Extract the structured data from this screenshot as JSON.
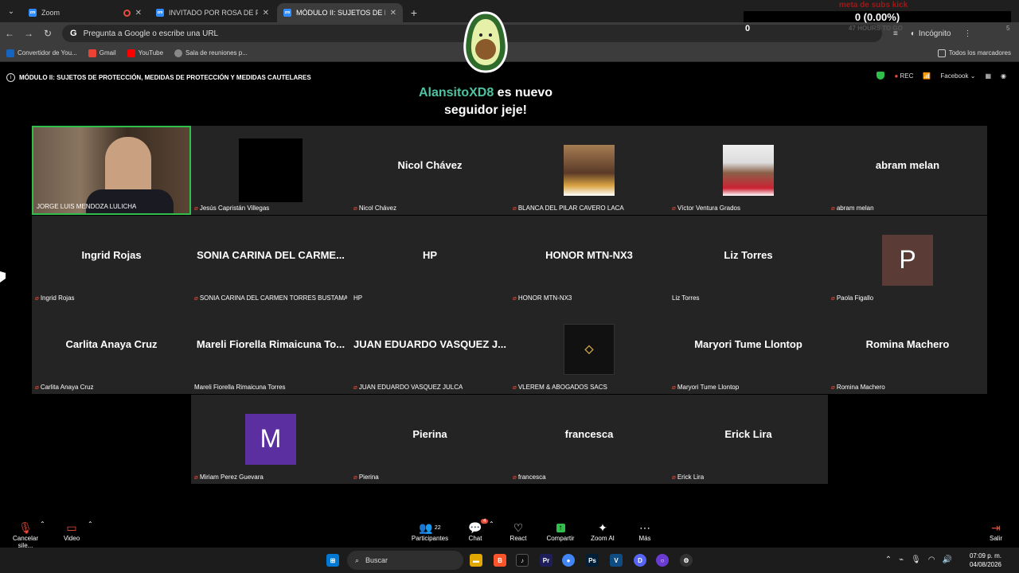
{
  "browser": {
    "tabs": [
      {
        "title": "Zoom",
        "favicon": "zoom-icon",
        "active": false
      },
      {
        "title": "INVITADO POR ROSA DE PAZ",
        "favicon": "zoom-icon",
        "active": false
      },
      {
        "title": "MÓDULO II: SUJETOS DE PF",
        "favicon": "zoom-icon",
        "active": true
      }
    ],
    "omnibox_placeholder": "Pregunta a Google o escribe una URL",
    "incognito_label": "Incógnito",
    "bookmarks": [
      "Convertidor de You...",
      "Gmail",
      "YouTube",
      "Sala de reuniones p..."
    ],
    "bookmarks_all": "Todos los marcadores"
  },
  "overlay": {
    "subs_title": "meta de subs kick",
    "subs_count": "0 (0.00%)",
    "subs_start": "0",
    "subs_hours": "47 HOURS TO GO",
    "subs_goal": "5",
    "follower_name": "AlansitoXD8",
    "follower_text_1": "es nuevo",
    "follower_text_2": "seguidor jeje!"
  },
  "meeting": {
    "title": "MÓDULO II: SUJETOS DE PROTECCIÓN, MEDIDAS DE PROTECCIÓN Y MEDIDAS CAUTELARES",
    "rec_label": "REC",
    "stream_label": "Facebook",
    "colors": {
      "green": "#2fbf4a",
      "red": "#e74c3c",
      "accent": "#4fc3a1"
    }
  },
  "participants": [
    {
      "label": "JORGE LUIS MENDOZA LULICHA",
      "display": "",
      "kind": "video",
      "muted": false,
      "speaking": true
    },
    {
      "label": "Jesús Capristán Villegas",
      "display": "",
      "kind": "black",
      "muted": true
    },
    {
      "label": "Nicol Chávez",
      "display": "Nicol Chávez",
      "kind": "name",
      "muted": true
    },
    {
      "label": "BLANCA DEL PILAR CAVERO LACA",
      "display": "",
      "kind": "photo-woman",
      "muted": true
    },
    {
      "label": "Víctor Ventura Grados",
      "display": "",
      "kind": "photo-man",
      "muted": true
    },
    {
      "label": "abram melan",
      "display": "abram melan",
      "kind": "name",
      "muted": true
    },
    {
      "label": "Ingrid Rojas",
      "display": "Ingrid Rojas",
      "kind": "name",
      "muted": true
    },
    {
      "label": "SONIA CARINA DEL CARMEN TORRES BUSTAMA...",
      "display": "SONIA CARINA DEL CARME...",
      "kind": "name",
      "muted": true
    },
    {
      "label": "HP",
      "display": "HP",
      "kind": "name",
      "muted": false
    },
    {
      "label": "HONOR MTN-NX3",
      "display": "HONOR MTN-NX3",
      "kind": "name",
      "muted": true
    },
    {
      "label": "Liz Torres",
      "display": "Liz Torres",
      "kind": "name",
      "muted": false
    },
    {
      "label": "Paola Figallo",
      "display": "P",
      "kind": "letter",
      "color": "#5a3b35",
      "muted": true
    },
    {
      "label": "Carlita Anaya Cruz",
      "display": "Carlita Anaya Cruz",
      "kind": "name",
      "muted": true
    },
    {
      "label": "Mareli Fiorella Rimaicuna Torres",
      "display": "Mareli Fiorella Rimaicuna To...",
      "kind": "name",
      "muted": false
    },
    {
      "label": "JUAN EDUARDO VASQUEZ JULCA",
      "display": "JUAN EDUARDO VASQUEZ J...",
      "kind": "name",
      "muted": true
    },
    {
      "label": "VLEREM & ABOGADOS SACS",
      "display": "",
      "kind": "logo",
      "muted": true
    },
    {
      "label": "Maryori Tume Llontop",
      "display": "Maryori Tume Llontop",
      "kind": "name",
      "muted": true
    },
    {
      "label": "Romina Machero",
      "display": "Romina Machero",
      "kind": "name",
      "muted": true
    },
    {
      "label": "Miriam Perez Guevara",
      "display": "M",
      "kind": "letter",
      "color": "#5b2fa0",
      "muted": true
    },
    {
      "label": "Pierina",
      "display": "Pierina",
      "kind": "name",
      "muted": true
    },
    {
      "label": "francesca",
      "display": "francesca",
      "kind": "name",
      "muted": true
    },
    {
      "label": "Erick Lira",
      "display": "Erick Lira",
      "kind": "name",
      "muted": true
    }
  ],
  "toolbar": {
    "mute_label": "Cancelar sile...",
    "video_label": "Video",
    "participants_label": "Participantes",
    "participants_count": "22",
    "chat_label": "Chat",
    "chat_badge": "4",
    "react_label": "React",
    "share_label": "Compartir",
    "ai_label": "Zoom AI",
    "more_label": "Más",
    "leave_label": "Salir"
  },
  "taskbar": {
    "search_placeholder": "Buscar",
    "time": "07:09 p. m.",
    "date": "04/08/2026"
  }
}
